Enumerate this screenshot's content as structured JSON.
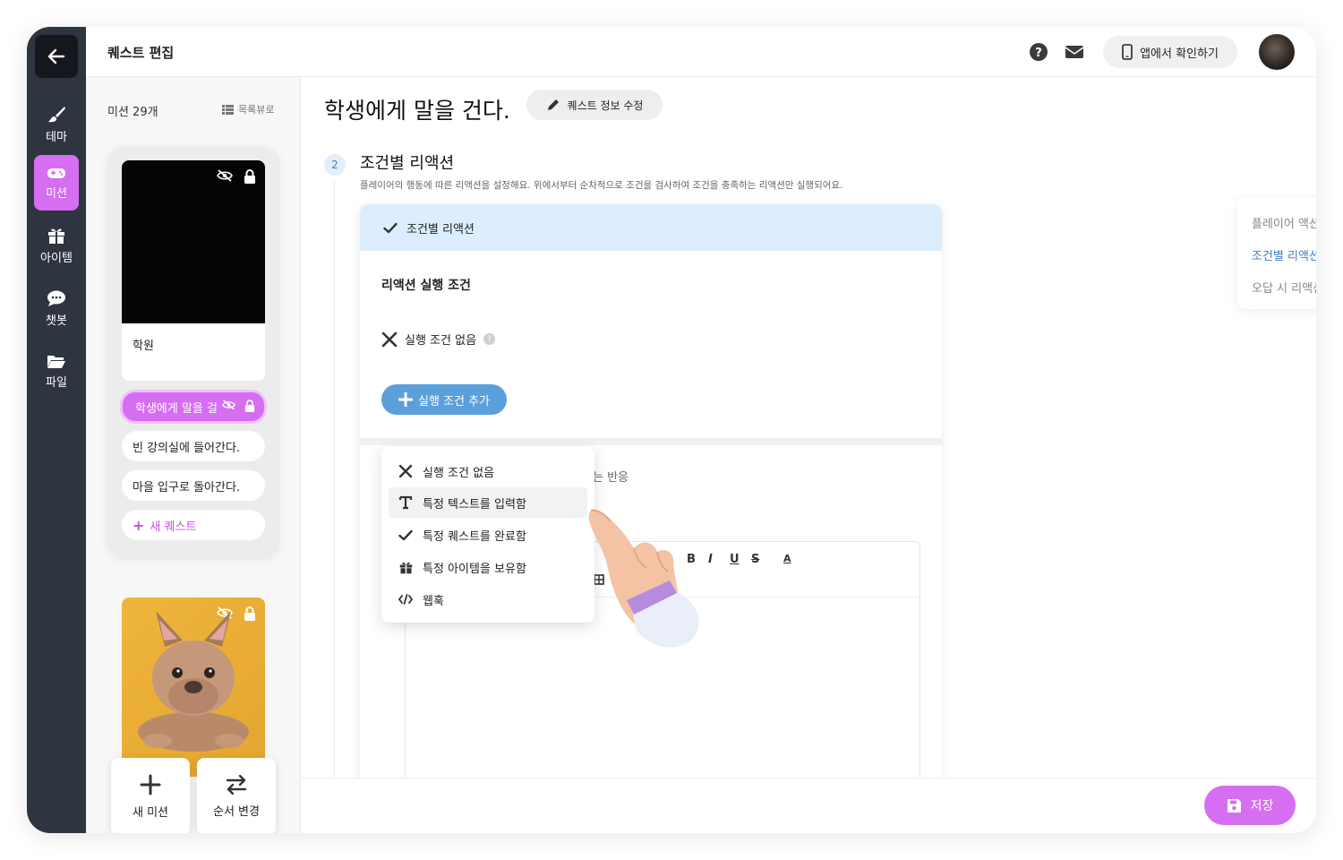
{
  "header": {
    "title": "퀘스트 편집",
    "app_check_button": "앱에서 확인하기",
    "icons": [
      "help-icon",
      "mail-icon",
      "mobile-icon"
    ]
  },
  "rail": {
    "items": [
      {
        "label": "테마",
        "icon": "brush-icon"
      },
      {
        "label": "미션",
        "icon": "gamepad-icon"
      },
      {
        "label": "아이템",
        "icon": "gift-icon"
      },
      {
        "label": "챗봇",
        "icon": "chat-icon"
      },
      {
        "label": "파일",
        "icon": "folder-icon"
      }
    ]
  },
  "mission_list": {
    "count_label": "미션 29개",
    "view_toggle": "목록뷰로",
    "mission_title": "학원",
    "quests": [
      "학생에게 말을 걸",
      "빈 강의실에 들어간다.",
      "마을 입구로 돌아간다."
    ],
    "new_quest": "새 퀘스트",
    "new_mission": "새 미션",
    "reorder": "순서 변경"
  },
  "main": {
    "quest_title": "학생에게 말을 건다.",
    "edit_info_button": "퀘스트 정보 수정",
    "step_number": "2",
    "section_title": "조건별 리액션",
    "section_desc": "플레이어의 행동에 따른 리액션을 설정해요. 위에서부터 순차적으로 조건을 검사하여 조건을 충족하는 리액션만 실행되어요.",
    "reaction_header": "조건별 리액션",
    "condition_title": "리액션 실행 조건",
    "no_condition": "실행 조건 없음",
    "add_condition_button": "실행 조건 추가",
    "response_label_partial": "는 반응",
    "toolbar": [
      "B",
      "I",
      "U",
      "S",
      "A"
    ]
  },
  "dropdown": {
    "items": [
      {
        "label": "실행 조건 없음",
        "icon": "close-icon"
      },
      {
        "label": "특정 텍스트를 입력함",
        "icon": "text-icon"
      },
      {
        "label": "특정 퀘스트를 완료함",
        "icon": "check-icon"
      },
      {
        "label": "특정 아이템을 보유함",
        "icon": "gift-icon"
      },
      {
        "label": "웹훅",
        "icon": "code-icon"
      }
    ]
  },
  "toc": {
    "items": [
      "플레이어 액션",
      "조건별 리액션",
      "오답 시 리액션"
    ],
    "active": "조건별 리액션"
  },
  "save_button": "저장",
  "colors": {
    "accent": "#d56ef0",
    "rail_bg": "#2f3441",
    "primary_blue": "#5b9fdb",
    "header_tint": "#dceefd"
  }
}
